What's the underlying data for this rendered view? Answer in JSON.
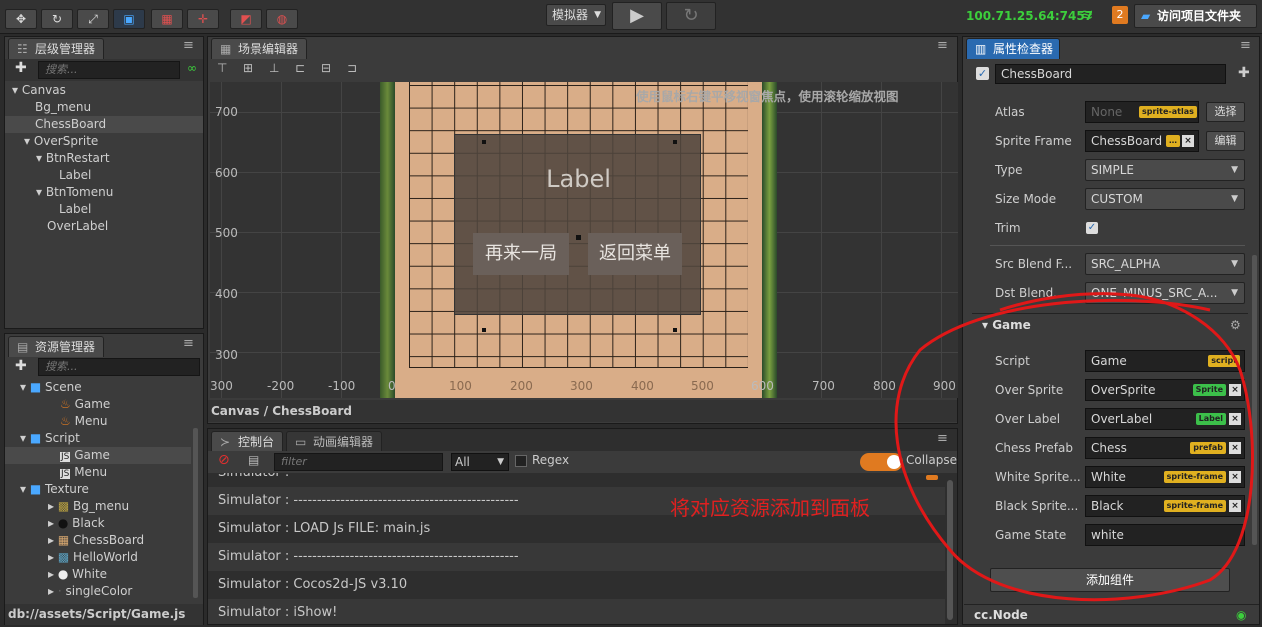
{
  "toolbar": {
    "tools": [
      "move-tool",
      "rotate-tool",
      "scale-tool",
      "rect-tool"
    ],
    "simulator_select": "模拟器",
    "play_icon": "▶",
    "refresh_icon": "↻",
    "ip": "100.71.25.64:7457",
    "notification_count": "2",
    "open_project_label": "访问项目文件夹"
  },
  "hierarchy": {
    "title": "层级管理器",
    "search_placeholder": "搜索...",
    "items": [
      "Canvas",
      "Bg_menu",
      "ChessBoard",
      "OverSprite",
      "BtnRestart",
      "Label",
      "BtnTomenu",
      "Label",
      "OverLabel"
    ]
  },
  "assets": {
    "title": "资源管理器",
    "search_placeholder": "搜索...",
    "items": [
      "Scene",
      "Game",
      "Menu",
      "Script",
      "Game",
      "Menu",
      "Texture",
      "Bg_menu",
      "Black",
      "ChessBoard",
      "HelloWorld",
      "White",
      "singleColor"
    ],
    "status_path": "db://assets/Script/Game.js"
  },
  "scene": {
    "title": "场景编辑器",
    "hint": "使用鼠标右键平移视窗焦点，使用滚轮缩放视图",
    "y_labels": [
      "700",
      "600",
      "500",
      "400",
      "300"
    ],
    "x_labels": [
      "300",
      "-200",
      "-100",
      "0",
      "100",
      "200",
      "300",
      "400",
      "500",
      "600",
      "700",
      "800",
      "900"
    ],
    "label_text": "Label",
    "btn_restart": "再来一局",
    "btn_menu": "返回菜单",
    "breadcrumb": "Canvas / ChessBoard"
  },
  "console": {
    "tab_console": "控制台",
    "tab_anim": "动画编辑器",
    "filter_placeholder": "filter",
    "level_select": "All",
    "regex_label": "Regex",
    "collapse_label": "Collapse",
    "lines": [
      "Simulator : ------------------------------------------------",
      "Simulator : ------------------------------------------------",
      "Simulator : LOAD Js FILE: main.js",
      "Simulator : ------------------------------------------------",
      "Simulator : Cocos2d-JS v3.10",
      "Simulator : iShow!"
    ],
    "annotation": "将对应资源添加到面板"
  },
  "inspector": {
    "title": "属性检查器",
    "node_name": "ChessBoard",
    "atlas_label": "Atlas",
    "atlas_value": "None",
    "atlas_tag": "sprite-atlas",
    "select_btn": "选择",
    "sprite_frame_label": "Sprite Frame",
    "sprite_frame_value": "ChessBoard",
    "edit_btn": "编辑",
    "type_label": "Type",
    "type_value": "SIMPLE",
    "size_mode_label": "Size Mode",
    "size_mode_value": "CUSTOM",
    "trim_label": "Trim",
    "src_blend_label": "Src Blend F...",
    "src_blend_value": "SRC_ALPHA",
    "dst_blend_label": "Dst Blend...",
    "dst_blend_value": "ONE_MINUS_SRC_A...",
    "game_section": "Game",
    "rows": [
      {
        "label": "Script",
        "value": "Game",
        "tag": "script",
        "tagColor": "#e0b020"
      },
      {
        "label": "Over Sprite",
        "value": "OverSprite",
        "tag": "Sprite",
        "tagColor": "#3cc04a"
      },
      {
        "label": "Over Label",
        "value": "OverLabel",
        "tag": "Label",
        "tagColor": "#3cc04a"
      },
      {
        "label": "Chess Prefab",
        "value": "Chess",
        "tag": "prefab",
        "tagColor": "#e0b020"
      },
      {
        "label": "White Sprite...",
        "value": "White",
        "tag": "sprite-frame",
        "tagColor": "#e0b020"
      },
      {
        "label": "Black Sprite...",
        "value": "Black",
        "tag": "sprite-frame",
        "tagColor": "#e0b020"
      }
    ],
    "game_state_label": "Game State",
    "game_state_value": "white",
    "add_component": "添加组件",
    "footer_node": "cc.Node"
  }
}
